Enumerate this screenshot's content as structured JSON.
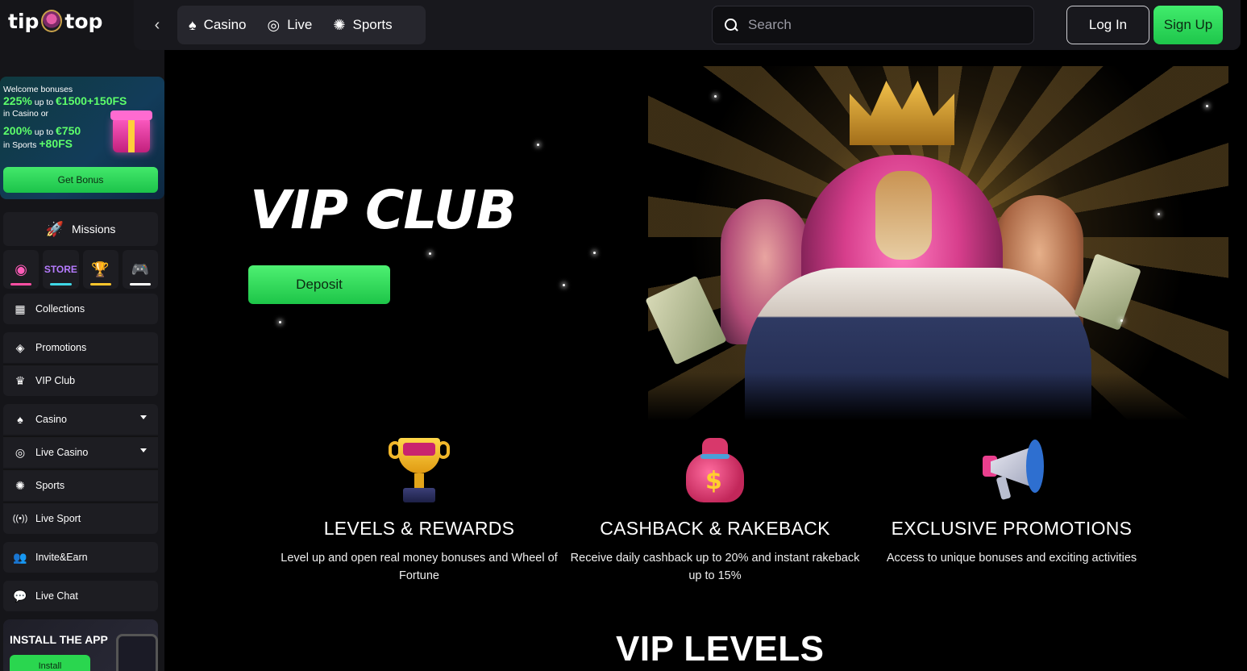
{
  "brand": {
    "logo_left": "tip",
    "logo_right": "top"
  },
  "header": {
    "categories": [
      {
        "label": "Casino",
        "icon": "spade-icon"
      },
      {
        "label": "Live",
        "icon": "live-target-icon"
      },
      {
        "label": "Sports",
        "icon": "basketball-icon"
      }
    ],
    "search_placeholder": "Search",
    "login_label": "Log In",
    "signup_label": "Sign Up"
  },
  "sidebar": {
    "bonus": {
      "line1": "Welcome bonuses",
      "casino_pct": "225%",
      "casino_upto": " up to ",
      "casino_amount": "€1500+150FS",
      "casino_suffix": "in Casino or",
      "sports_pct": "200%",
      "sports_upto": " up to ",
      "sports_amount": "€750",
      "sports_prefix": "in Sports ",
      "sports_fs": "+80FS",
      "button": "Get Bonus"
    },
    "missions_label": "Missions",
    "items": [
      {
        "label": "Collections"
      },
      {
        "label": "Promotions"
      },
      {
        "label": "VIP Club"
      },
      {
        "label": "Casino"
      },
      {
        "label": "Live Casino"
      },
      {
        "label": "Sports"
      },
      {
        "label": "Live Sport"
      },
      {
        "label": "Invite&Earn"
      },
      {
        "label": "Live Chat"
      }
    ],
    "install": {
      "title": "INSTALL THE APP",
      "button": "Install"
    }
  },
  "hero": {
    "title": "VIP CLUB",
    "deposit_label": "Deposit"
  },
  "features": [
    {
      "title": "LEVELS & REWARDS",
      "text": "Level up and open real money bonuses and Wheel of Fortune"
    },
    {
      "title": "CASHBACK & RAKEBACK",
      "text": "Receive daily cashback up to 20% and instant rakeback up to 15%"
    },
    {
      "title": "EXCLUSIVE PROMOTIONS",
      "text": "Access to unique bonuses and exciting activities"
    }
  ],
  "vip_levels_title": "VIP LEVELS",
  "colors": {
    "accent_green": "#2ad64f",
    "bg": "#000000",
    "panel": "#1d1d22"
  }
}
